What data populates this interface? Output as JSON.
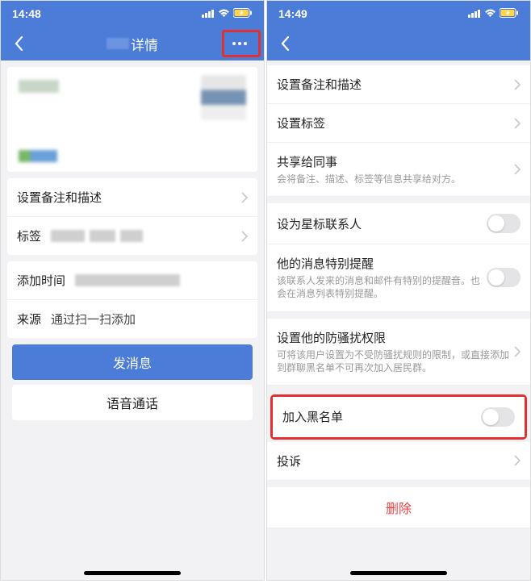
{
  "left": {
    "status": {
      "time": "14:48"
    },
    "nav": {
      "title_suffix": "详情"
    },
    "rows": {
      "remark_label": "设置备注和描述",
      "tags_label": "标签",
      "add_time_label": "添加时间",
      "source_label": "来源",
      "source_value": "通过扫一扫添加"
    },
    "buttons": {
      "send_msg": "发消息",
      "voice_call": "语音通话"
    }
  },
  "right": {
    "status": {
      "time": "14:49"
    },
    "rows": {
      "remark": "设置备注和描述",
      "set_tags": "设置标签",
      "share_colleague": "共享给同事",
      "share_colleague_sub": "会将备注、描述、标签等信息共享给对方。",
      "star": "设为星标联系人",
      "special_notify": "他的消息特别提醒",
      "special_notify_sub": "该联系人发来的消息和邮件有特别的提醒音。也会在消息列表特别提醒。",
      "anti_harass": "设置他的防骚扰权限",
      "anti_harass_sub": "可将该用户设置为不受防骚扰规则的限制，或直接添加到群聊黑名单不可再次加入居民群。",
      "blacklist": "加入黑名单",
      "complain": "投诉",
      "delete": "删除"
    }
  }
}
